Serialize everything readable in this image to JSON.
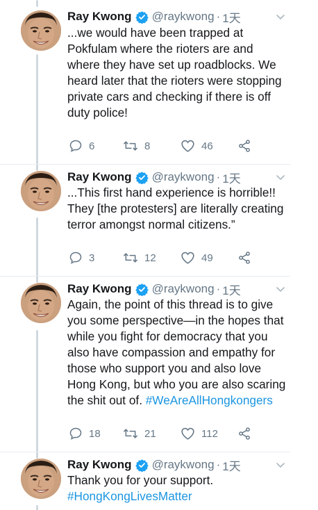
{
  "tweets": [
    {
      "name": "Ray Kwong",
      "handle": "@raykwong",
      "separator": "·",
      "time": "1天",
      "text": "...we would have been trapped at\nPokfulam where the rioters are and\nwhere they have set up roadblocks. We\nheard later that the rioters were stopping\nprivate cars and checking if there is off\nduty police!",
      "hashtag": "",
      "replies": "6",
      "retweets": "8",
      "likes": "46"
    },
    {
      "name": "Ray Kwong",
      "handle": "@raykwong",
      "separator": "·",
      "time": "1天",
      "text": "...This first hand experience is horrible!!\nThey [the protesters] are literally creating\nterror amongst normal citizens.”",
      "hashtag": "",
      "replies": "3",
      "retweets": "12",
      "likes": "49"
    },
    {
      "name": "Ray Kwong",
      "handle": "@raykwong",
      "separator": "·",
      "time": "1天",
      "text": "Again, the point of this thread is to give\nyou some perspective—in the hopes that\nwhile you fight for democracy that you\nalso have compassion and empathy for\nthose who support you and also love\nHong Kong, but who you are also scaring\nthe shit out of. ",
      "hashtag": "#WeAreAllHongkongers",
      "replies": "18",
      "retweets": "21",
      "likes": "112"
    },
    {
      "name": "Ray Kwong",
      "handle": "@raykwong",
      "separator": "·",
      "time": "1天",
      "text": "Thank you for your support.\n",
      "hashtag": "#HongKongLivesMatter"
    }
  ],
  "icons": {
    "verified": "verified-badge-icon",
    "caret": "chevron-down-icon",
    "reply": "reply-icon",
    "retweet": "retweet-icon",
    "like": "heart-icon",
    "share": "share-icon"
  },
  "colors": {
    "text": "#14171a",
    "muted": "#657786",
    "link": "#1b95e0",
    "verified": "#1da1f2",
    "thread_line": "#cfd9de"
  }
}
